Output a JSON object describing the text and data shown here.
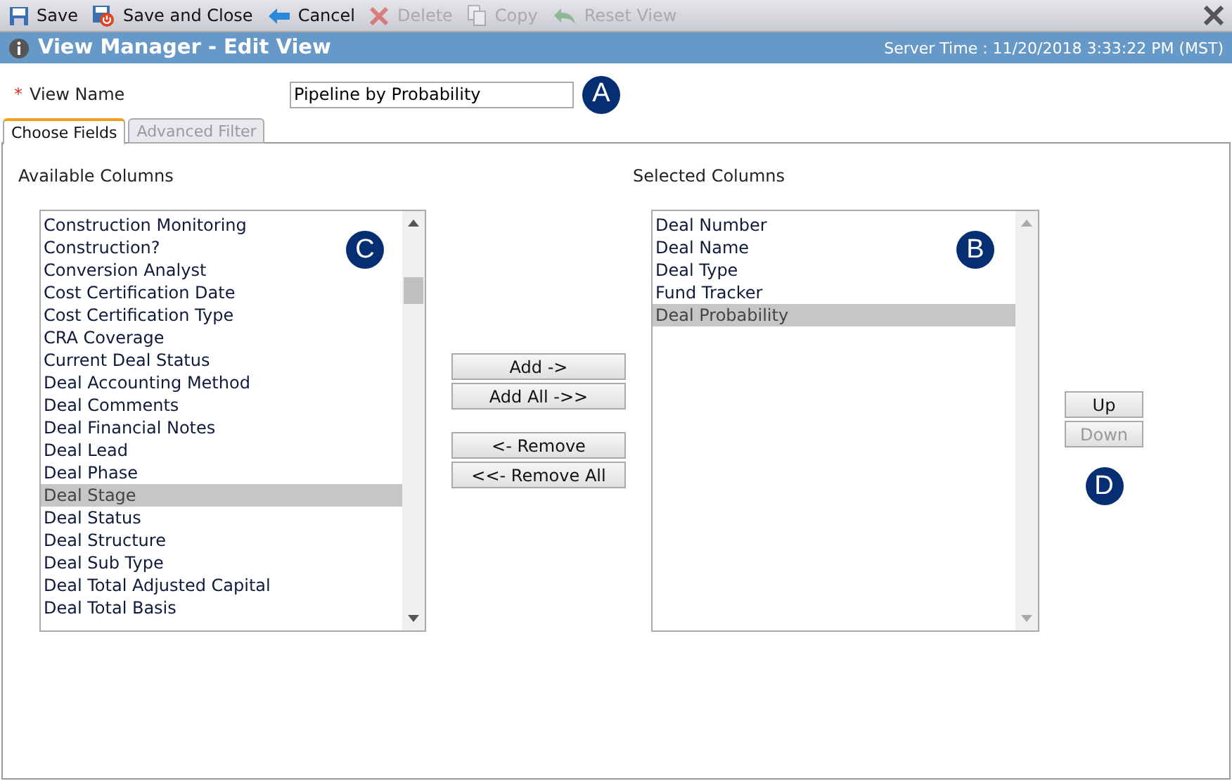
{
  "toolbar": [
    {
      "label": "Save",
      "kind": "save",
      "disabled": false
    },
    {
      "label": "Save and Close",
      "kind": "save-close",
      "disabled": false
    },
    {
      "label": "Cancel",
      "kind": "cancel",
      "disabled": false
    },
    {
      "label": "Delete",
      "kind": "delete",
      "disabled": true
    },
    {
      "label": "Copy",
      "kind": "copy",
      "disabled": true
    },
    {
      "label": "Reset View",
      "kind": "reset",
      "disabled": true
    }
  ],
  "header": {
    "title": "View Manager - Edit View",
    "server_time": "Server Time : 11/20/2018 3:33:22 PM (MST)"
  },
  "view_name": {
    "required_mark": "*",
    "label": "View Name",
    "value": "Pipeline by Probability",
    "badge": "A"
  },
  "tabs": [
    {
      "label": "Choose Fields",
      "selected": true
    },
    {
      "label": "Advanced Filter",
      "selected": false
    }
  ],
  "available": {
    "label": "Available Columns",
    "badge": "C",
    "items": [
      {
        "label": "Construction Monitoring",
        "selected": false
      },
      {
        "label": "Construction?",
        "selected": false
      },
      {
        "label": "Conversion Analyst",
        "selected": false
      },
      {
        "label": "Cost Certification Date",
        "selected": false
      },
      {
        "label": "Cost Certification Type",
        "selected": false
      },
      {
        "label": "CRA Coverage",
        "selected": false
      },
      {
        "label": "Current Deal Status",
        "selected": false
      },
      {
        "label": "Deal Accounting Method",
        "selected": false
      },
      {
        "label": "Deal Comments",
        "selected": false
      },
      {
        "label": "Deal Financial Notes",
        "selected": false
      },
      {
        "label": "Deal Lead",
        "selected": false
      },
      {
        "label": "Deal Phase",
        "selected": false
      },
      {
        "label": "Deal Stage",
        "selected": true
      },
      {
        "label": "Deal Status",
        "selected": false
      },
      {
        "label": "Deal Structure",
        "selected": false
      },
      {
        "label": "Deal Sub Type",
        "selected": false
      },
      {
        "label": "Deal Total Adjusted Capital",
        "selected": false
      },
      {
        "label": "Deal Total Basis",
        "selected": false
      }
    ]
  },
  "transfer_buttons": [
    [
      "Add ->",
      "Add All ->>"
    ],
    [
      "<- Remove",
      "<<- Remove All"
    ]
  ],
  "selected": {
    "label": "Selected Columns",
    "badge": "B",
    "items": [
      {
        "label": "Deal Number",
        "selected": false
      },
      {
        "label": "Deal Name",
        "selected": false
      },
      {
        "label": "Deal Type",
        "selected": false
      },
      {
        "label": "Fund Tracker",
        "selected": false
      },
      {
        "label": "Deal Probability",
        "selected": true
      }
    ]
  },
  "order_buttons": [
    {
      "label": "Up",
      "disabled": false
    },
    {
      "label": "Down",
      "disabled": true
    }
  ],
  "order_badge": "D"
}
